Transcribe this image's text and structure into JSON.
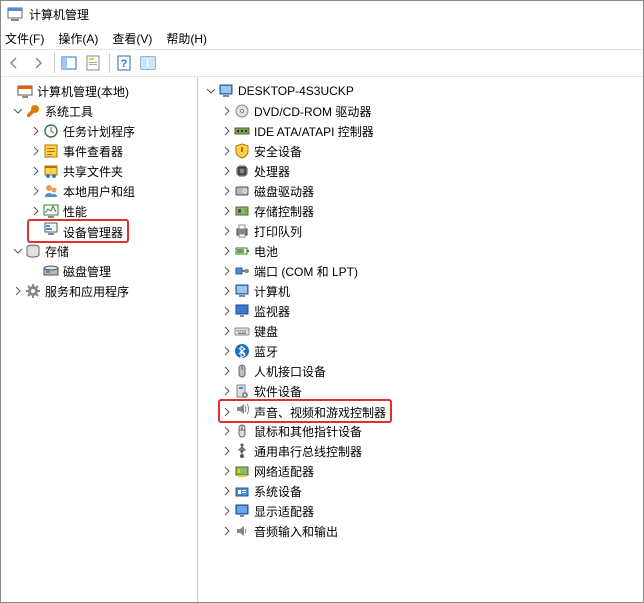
{
  "title": "计算机管理",
  "menus": {
    "file": "文件(F)",
    "action": "操作(A)",
    "view": "查看(V)",
    "help": "帮助(H)"
  },
  "left_tree": {
    "root": "计算机管理(本地)",
    "tools": {
      "label": "系统工具",
      "children": [
        {
          "label": "任务计划程序",
          "exp": true
        },
        {
          "label": "事件查看器",
          "exp": true
        },
        {
          "label": "共享文件夹",
          "exp": true
        },
        {
          "label": "本地用户和组",
          "exp": true
        },
        {
          "label": "性能",
          "exp": true
        },
        {
          "label": "设备管理器",
          "exp": false,
          "hl": true
        }
      ]
    },
    "storage": {
      "label": "存储",
      "children": [
        {
          "label": "磁盘管理"
        }
      ]
    },
    "services": {
      "label": "服务和应用程序"
    }
  },
  "right_tree": {
    "root": "DESKTOP-4S3UCKP",
    "items": [
      {
        "label": "DVD/CD-ROM 驱动器"
      },
      {
        "label": "IDE ATA/ATAPI 控制器"
      },
      {
        "label": "安全设备"
      },
      {
        "label": "处理器"
      },
      {
        "label": "磁盘驱动器"
      },
      {
        "label": "存储控制器"
      },
      {
        "label": "打印队列"
      },
      {
        "label": "电池"
      },
      {
        "label": "端口 (COM 和 LPT)"
      },
      {
        "label": "计算机"
      },
      {
        "label": "监视器"
      },
      {
        "label": "键盘"
      },
      {
        "label": "蓝牙"
      },
      {
        "label": "人机接口设备"
      },
      {
        "label": "软件设备"
      },
      {
        "label": "声音、视频和游戏控制器",
        "hl": true
      },
      {
        "label": "鼠标和其他指针设备"
      },
      {
        "label": "通用串行总线控制器"
      },
      {
        "label": "网络适配器"
      },
      {
        "label": "系统设备"
      },
      {
        "label": "显示适配器"
      },
      {
        "label": "音频输入和输出"
      }
    ]
  }
}
